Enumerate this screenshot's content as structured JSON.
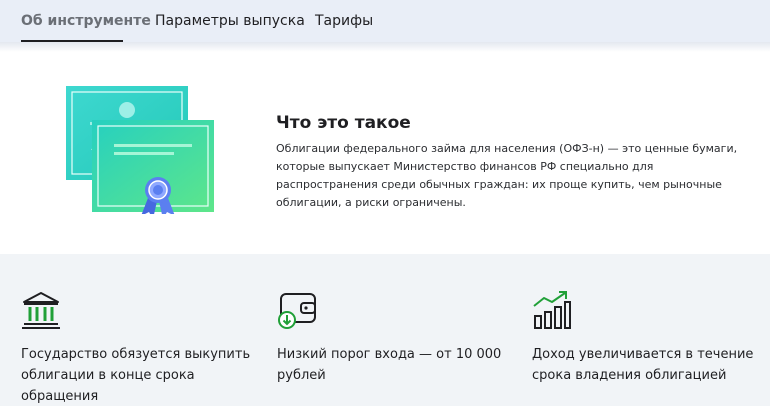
{
  "tabs": [
    {
      "label": "Об инструменте",
      "active": true
    },
    {
      "label": "Параметры выпуска",
      "active": false
    },
    {
      "label": "Тарифы",
      "active": false
    }
  ],
  "about": {
    "title": "Что это такое",
    "description": "Облигации федерального займа для населения (ОФЗ-н) — это ценные бумаги, которые выпускает Министерство финансов РФ специально для распространения среди обычных граждан: их проще купить, чем рыночные облигации, а риски ограничены.",
    "illustration_icon": "certificate-illustration"
  },
  "features": [
    {
      "icon": "bank-building-icon",
      "text": "Государство обязуется выкупить облигации в конце срока обращения"
    },
    {
      "icon": "wallet-icon",
      "text": "Низкий порог входа — от 10 000 рублей"
    },
    {
      "icon": "growth-chart-icon",
      "text": "Доход увеличивается в течение срока владения облигацией"
    }
  ],
  "colors": {
    "tab_bar_bg": "#e9eef7",
    "features_bg": "#f1f4f7",
    "icon_green": "#21a038",
    "icon_dark": "#1f1f22",
    "accent_teal": "#27d3c4",
    "accent_green": "#4ce08a",
    "ribbon_blue": "#5b7ff0"
  }
}
